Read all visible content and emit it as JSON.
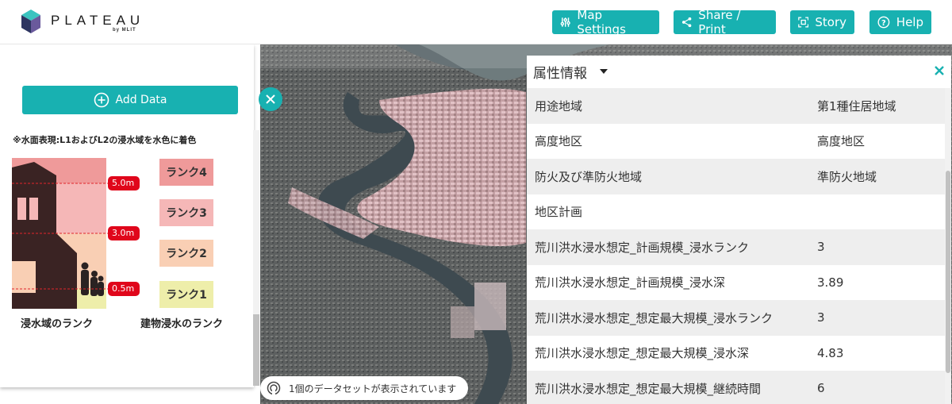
{
  "header": {
    "logo_text": "PLATEAU",
    "logo_sub": "by MLIT",
    "buttons": {
      "map_settings": "Map Settings",
      "share_print": "Share / Print",
      "story": "Story",
      "help": "Help"
    }
  },
  "left_panel": {
    "add_data_label": "Add Data",
    "note": "※水面表現:L1およびL2の浸水域を水色に着色",
    "depth_markers": [
      "5.0m",
      "3.0m",
      "0.5m"
    ],
    "ranks": [
      "ランク4",
      "ランク3",
      "ランク2",
      "ランク1"
    ],
    "caption_left": "浸水域のランク",
    "caption_right": "建物浸水のランク"
  },
  "map": {
    "status_text": "1個のデータセットが表示されています"
  },
  "attributes": {
    "title": "属性情報",
    "rows": [
      {
        "key": "用途地域",
        "value": "第1種住居地域"
      },
      {
        "key": "高度地区",
        "value": "高度地区"
      },
      {
        "key": "防火及び準防火地域",
        "value": "準防火地域"
      },
      {
        "key": "地区計画",
        "value": ""
      },
      {
        "key": "荒川洪水浸水想定_計画規模_浸水ランク",
        "value": "3"
      },
      {
        "key": "荒川洪水浸水想定_計画規模_浸水深",
        "value": "3.89"
      },
      {
        "key": "荒川洪水浸水想定_想定最大規模_浸水ランク",
        "value": "3"
      },
      {
        "key": "荒川洪水浸水想定_想定最大規模_浸水深",
        "value": "4.83"
      },
      {
        "key": "荒川洪水浸水想定_想定最大規模_継続時間",
        "value": "6"
      }
    ]
  },
  "colors": {
    "accent": "#18b1b1",
    "rank4": "#ef9a9a",
    "rank3": "#f5b7b7",
    "rank2": "#f9cfb4",
    "rank1": "#eeeeaa"
  },
  "icons": [
    "sliders-icon",
    "share-icon",
    "story-icon",
    "help-icon",
    "plus-circle-icon",
    "close-icon",
    "caret-down-icon",
    "layers-icon"
  ]
}
